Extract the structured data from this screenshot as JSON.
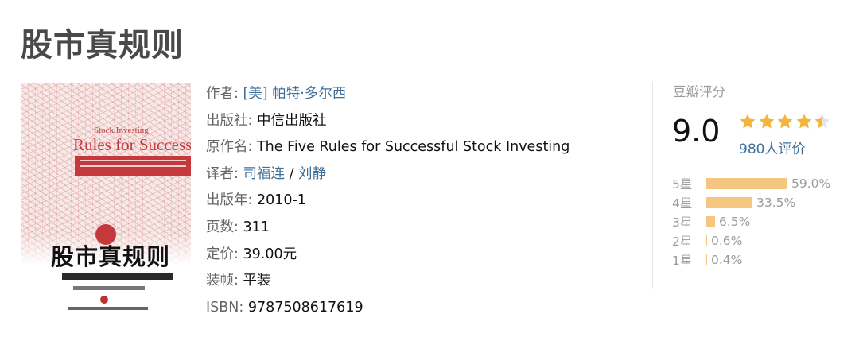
{
  "page": {
    "title": "股市真规则"
  },
  "cover": {
    "title_cn": "股市真规则",
    "title_en_small": "Stock Investing",
    "title_en_large": "Rules for Successful"
  },
  "info": {
    "author_label": "作者:",
    "author_prefix": "[美]",
    "author_name": "帕特·多尔西",
    "publisher_label": "出版社:",
    "publisher": "中信出版社",
    "original_title_label": "原作名:",
    "original_title": "The Five Rules for Successful Stock Investing",
    "translator_label": "译者:",
    "translator_1": "司福连",
    "translator_sep": "/",
    "translator_2": "刘静",
    "pub_year_label": "出版年:",
    "pub_year": "2010-1",
    "pages_label": "页数:",
    "pages": "311",
    "price_label": "定价:",
    "price": "39.00元",
    "binding_label": "装帧:",
    "binding": "平装",
    "isbn_label": "ISBN:",
    "isbn": "9787508617619"
  },
  "rating": {
    "header": "豆瓣评分",
    "score": "9.0",
    "stars_value": 4.5,
    "count_text": "980人评价",
    "star_color": "#f5b43c",
    "bar_color": "#f5c67f",
    "distribution": [
      {
        "label": "5星",
        "percent": "59.0%",
        "value": 59.0
      },
      {
        "label": "4星",
        "percent": "33.5%",
        "value": 33.5
      },
      {
        "label": "3星",
        "percent": "6.5%",
        "value": 6.5
      },
      {
        "label": "2星",
        "percent": "0.6%",
        "value": 0.6
      },
      {
        "label": "1星",
        "percent": "0.4%",
        "value": 0.4
      }
    ]
  }
}
